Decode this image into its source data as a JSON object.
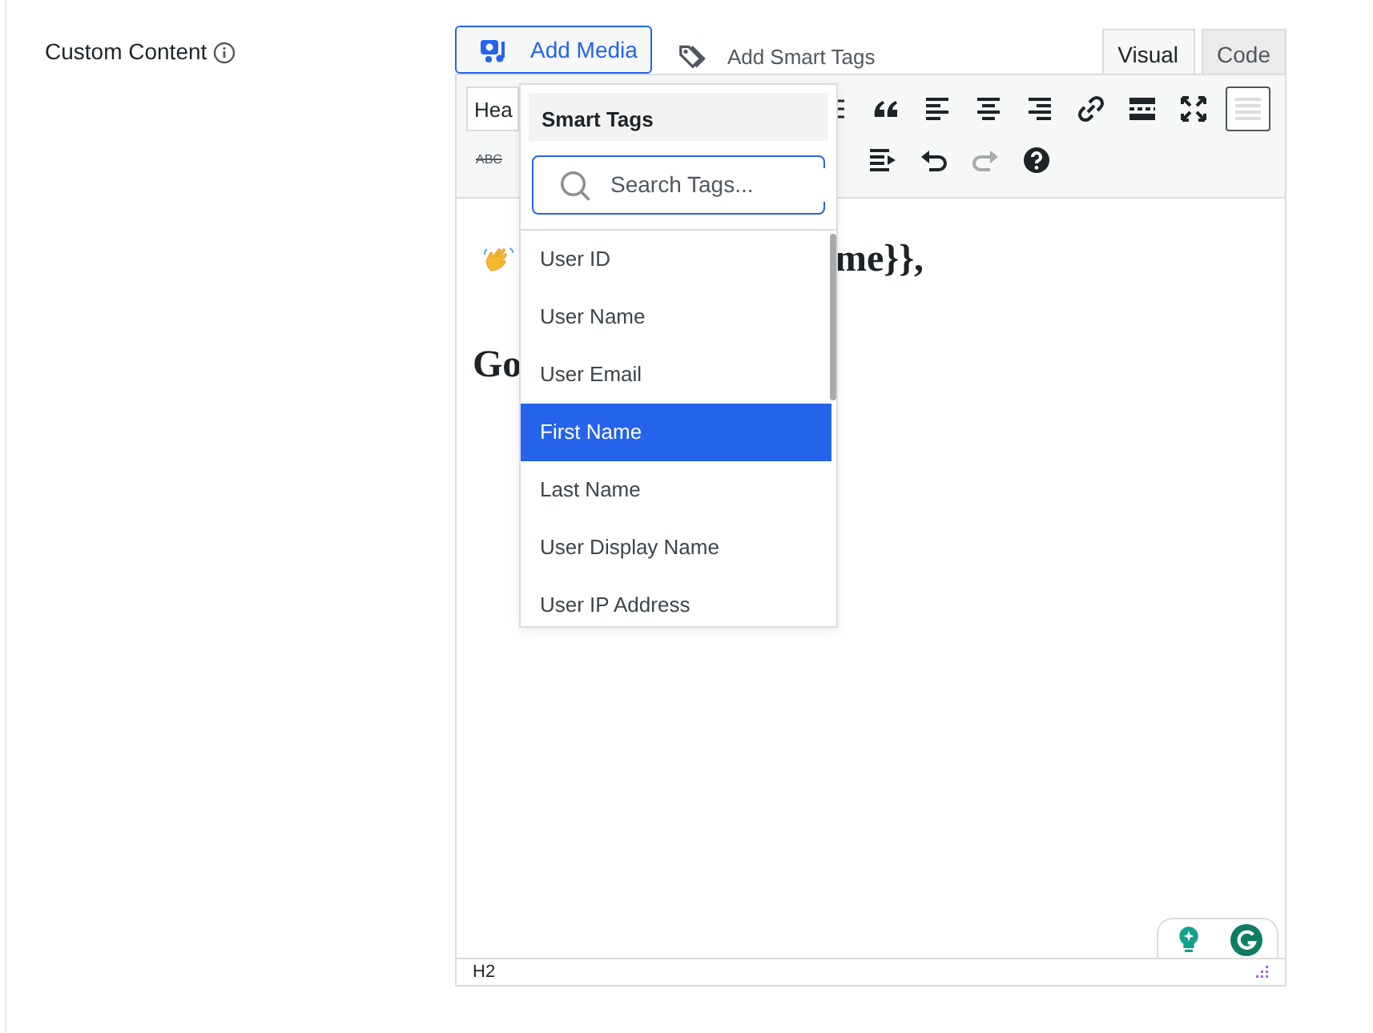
{
  "field": {
    "label": "Custom Content"
  },
  "media_button": {
    "label": "Add Media"
  },
  "tags_button": {
    "label": "Add Smart Tags"
  },
  "tabs": [
    {
      "label": "Visual",
      "selected": true
    },
    {
      "label": "Code",
      "selected": false
    }
  ],
  "editor": {
    "format_select": "Hea",
    "strikethrough_label": "ABC",
    "toolbar_toggle_on": true,
    "redo_disabled": true,
    "content": [
      {
        "kind": "greeting",
        "text": "me}},"
      },
      {
        "kind": "heading",
        "text": "Go"
      }
    ],
    "status": "H2"
  },
  "smart_tags": {
    "title": "Smart Tags",
    "search": {
      "placeholder": "Search Tags..."
    },
    "items": [
      {
        "label": "User ID",
        "selected": false
      },
      {
        "label": "User Name",
        "selected": false
      },
      {
        "label": "User Email",
        "selected": false
      },
      {
        "label": "First Name",
        "selected": true
      },
      {
        "label": "Last Name",
        "selected": false
      },
      {
        "label": "User Display Name",
        "selected": false
      },
      {
        "label": "User IP Address",
        "selected": false
      }
    ]
  }
}
